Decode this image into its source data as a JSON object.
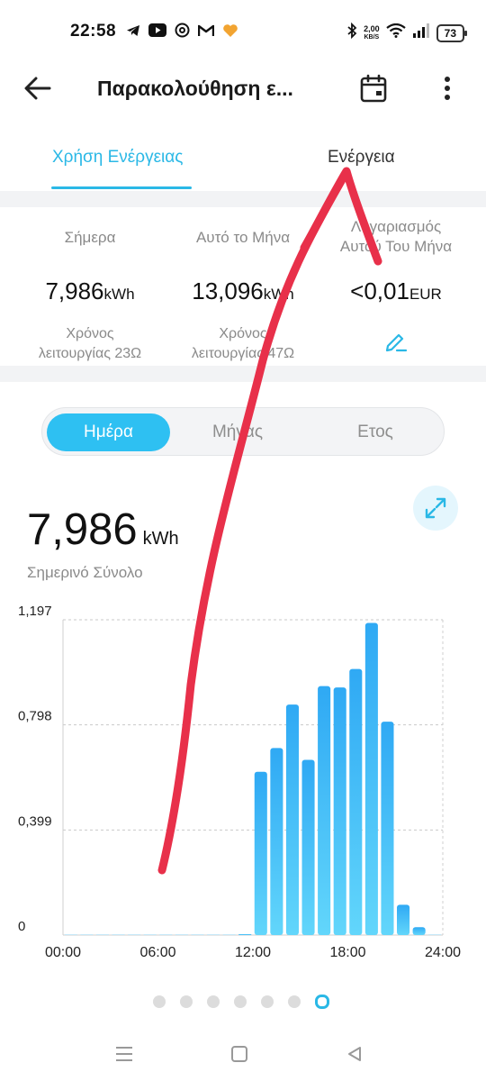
{
  "status_bar": {
    "time": "22:58",
    "speed_value": "2,00",
    "speed_unit": "KB/S",
    "battery": "73",
    "left_icons": [
      "telegram-icon",
      "youtube-icon",
      "threads-icon",
      "gmail-icon",
      "heart-icon"
    ],
    "right_icons": [
      "bluetooth-icon",
      "wifi-icon",
      "signal-icon",
      "battery-icon"
    ]
  },
  "app_bar": {
    "title": "Παρακολούθηση ε...",
    "icons": [
      "back-arrow-icon",
      "calendar-icon",
      "more-vert-icon"
    ]
  },
  "tabs": [
    {
      "label": "Χρήση Ενέργειας",
      "active": true
    },
    {
      "label": "Ενέργεια",
      "active": false
    }
  ],
  "stats": {
    "today": {
      "label": "Σήμερα",
      "value": "7,986",
      "unit": "kWh",
      "sub_line1": "Χρόνος",
      "sub_line2": "λειτουργίας 23Ω"
    },
    "month": {
      "label": "Αυτό το Μήνα",
      "value": "13,096",
      "unit": "kWh",
      "sub_line1": "Χρόνος",
      "sub_line2": "λειτουργίας 47Ω"
    },
    "bill": {
      "label_line1": "Λογαριασμός",
      "label_line2": "Αυτού Του Μήνα",
      "value": "<0,01",
      "unit": "EUR",
      "edit_icon": "pencil-icon"
    }
  },
  "segment": {
    "options": [
      "Ημέρα",
      "Μήνας",
      "Ετος"
    ],
    "selected": "Ημέρα"
  },
  "total": {
    "value": "7,986",
    "unit": "kWh",
    "label": "Σημερινό Σύνολο"
  },
  "colors": {
    "accent": "#2ab8e6",
    "segment_active": "#2ec0f2",
    "bar_top": "#2fa9f4",
    "bar_bottom": "#62d6fb",
    "annotation": "#e8304a"
  },
  "chart_data": {
    "type": "bar",
    "x": [
      "00",
      "01",
      "02",
      "03",
      "04",
      "05",
      "06",
      "07",
      "08",
      "09",
      "10",
      "11",
      "12",
      "13",
      "14",
      "15",
      "16",
      "17",
      "18",
      "19",
      "20",
      "21",
      "22",
      "23"
    ],
    "values": [
      0,
      0,
      0,
      0,
      0,
      0,
      0,
      0,
      0,
      0,
      0,
      0.003,
      0.62,
      0.71,
      0.875,
      0.665,
      0.945,
      0.94,
      1.01,
      1.185,
      0.81,
      0.115,
      0.03,
      0
    ],
    "ylim": [
      0,
      1.197
    ],
    "y_ticks": [
      "1,197",
      "0,798",
      "0,399",
      "0"
    ],
    "x_ticks": [
      "00:00",
      "06:00",
      "12:00",
      "18:00",
      "24:00"
    ],
    "grid": true,
    "xlabel": "",
    "ylabel": ""
  },
  "pager": {
    "count": 7,
    "active_index": 6
  },
  "nav_bar": {
    "icons": [
      "menu-icon",
      "home-icon",
      "back-triangle-icon"
    ]
  }
}
